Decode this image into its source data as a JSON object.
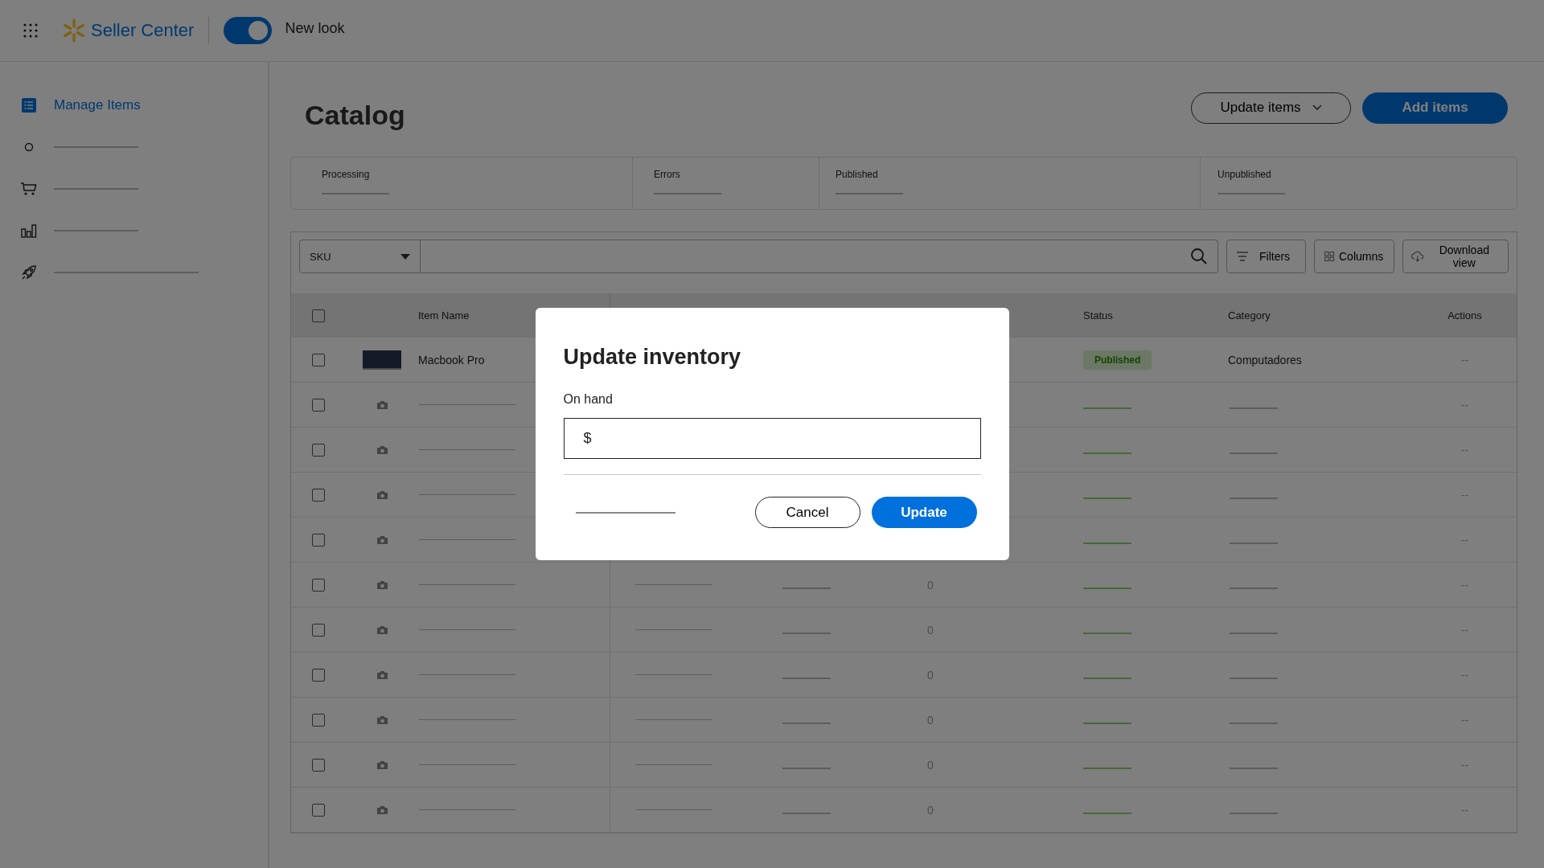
{
  "topbar": {
    "brand": "Seller Center",
    "toggle": {
      "label": "New look",
      "on": true
    }
  },
  "sidebar": {
    "items": [
      {
        "kind": "link",
        "label": "Manage Items",
        "selected": true
      },
      {
        "kind": "loading",
        "selected": false
      },
      {
        "kind": "loading",
        "selected": false
      },
      {
        "kind": "loading",
        "selected": false
      },
      {
        "kind": "loading",
        "selected": false
      }
    ]
  },
  "page": {
    "title": "Catalog",
    "buttons": [
      {
        "kind": "outline",
        "label": "Update items"
      },
      {
        "kind": "primary",
        "label": "Add items"
      }
    ]
  },
  "stats": [
    {
      "label": "Processing"
    },
    {
      "label": "Errors"
    },
    {
      "label": "Published"
    },
    {
      "label": "Unpublished"
    }
  ],
  "toolbar": {
    "search_by": "SKU",
    "buttons": [
      {
        "label": "Filters"
      },
      {
        "label": "Columns"
      },
      {
        "label": "Download view"
      }
    ]
  },
  "table": {
    "header": {
      "checked": false,
      "item_name": "Item Name",
      "status": "Status",
      "category": "Category",
      "actions": "Actions"
    },
    "rows": [
      {
        "kind": "item",
        "checked": false,
        "name": "Macbook Pro",
        "status": "Published",
        "category": "Computadores",
        "actions": "--"
      },
      {
        "kind": "loading",
        "checked": false,
        "actions": "--"
      },
      {
        "kind": "loading",
        "checked": false,
        "actions": "--"
      },
      {
        "kind": "loading",
        "checked": false,
        "actions": "--"
      },
      {
        "kind": "loading",
        "checked": false,
        "actions": "--"
      },
      {
        "kind": "loading",
        "checked": false,
        "inventory": "0",
        "actions": "--"
      },
      {
        "kind": "loading",
        "checked": false,
        "inventory": "0",
        "actions": "--"
      },
      {
        "kind": "loading",
        "checked": false,
        "inventory": "0",
        "actions": "--"
      },
      {
        "kind": "loading",
        "checked": false,
        "inventory": "0",
        "actions": "--"
      },
      {
        "kind": "loading",
        "checked": false,
        "inventory": "0",
        "actions": "--"
      },
      {
        "kind": "loading",
        "checked": false,
        "inventory": "0",
        "actions": "--"
      }
    ]
  },
  "dialog": {
    "title": "Update inventory",
    "field": {
      "label": "On hand",
      "prefix": "$"
    },
    "buttons": [
      {
        "kind": "secondary",
        "label": "Cancel"
      },
      {
        "kind": "primary",
        "label": "Update"
      }
    ]
  }
}
